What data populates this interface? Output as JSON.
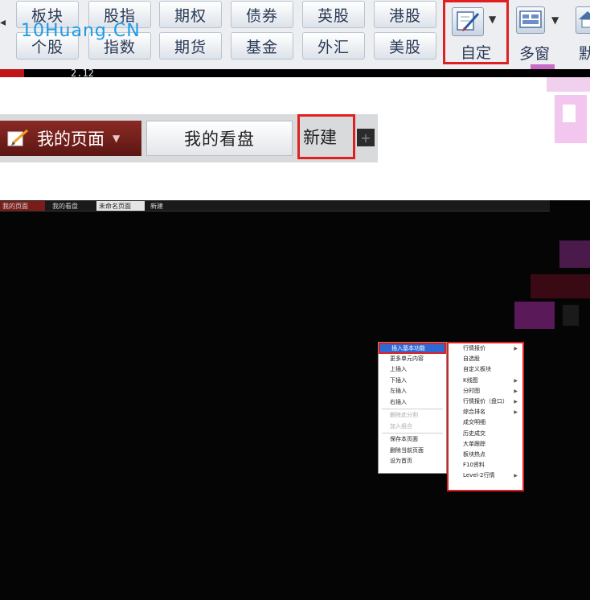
{
  "toolbar": {
    "row1": [
      "板块",
      "股指",
      "期权",
      "债券",
      "英股",
      "港股"
    ],
    "row2": [
      "个股",
      "指数",
      "期货",
      "基金",
      "外汇",
      "美股"
    ],
    "custom_label": "自定",
    "multi_label": "多窗",
    "home_label": "默",
    "quote_text": "2.12"
  },
  "brand": "10Huang.CN",
  "tabbar": {
    "my_page": "我的页面",
    "my_watch": "我的看盘",
    "new": "新建"
  },
  "screen": {
    "mini_tabs": [
      "我的页面",
      "我的看盘",
      "未命名页面",
      "新建"
    ],
    "context_menu": {
      "items": [
        {
          "label": "插入基本功能",
          "state": "selected"
        },
        {
          "label": "更多单元内容",
          "state": "normal"
        },
        {
          "label": "上插入",
          "state": "normal"
        },
        {
          "label": "下插入",
          "state": "normal"
        },
        {
          "label": "左插入",
          "state": "normal"
        },
        {
          "label": "右插入",
          "state": "normal"
        },
        {
          "label": "删除此分割",
          "state": "disabled"
        },
        {
          "label": "加入组合",
          "state": "disabled"
        },
        {
          "label": "保存本页面",
          "state": "normal"
        },
        {
          "label": "删除当前页面",
          "state": "normal"
        },
        {
          "label": "设为首页",
          "state": "normal"
        }
      ]
    },
    "submenu": {
      "items": [
        {
          "label": "行情报价",
          "arrow": true
        },
        {
          "label": "自选股",
          "arrow": false
        },
        {
          "label": "自定义板块",
          "arrow": false
        },
        {
          "label": "K线图",
          "arrow": true
        },
        {
          "label": "分时图",
          "arrow": true
        },
        {
          "label": "行情报价（盘口）",
          "arrow": true
        },
        {
          "label": "综合排名",
          "arrow": true
        },
        {
          "label": "成交明细",
          "arrow": false
        },
        {
          "label": "历史成交",
          "arrow": false
        },
        {
          "label": "大单跟踪",
          "arrow": false
        },
        {
          "label": "板块热点",
          "arrow": false
        },
        {
          "label": "F10资料",
          "arrow": false
        },
        {
          "label": "Level-2行情",
          "arrow": true
        }
      ]
    }
  },
  "colors": {
    "highlight_border": "#e02020",
    "tab_active": "#7a1c17",
    "menu_selected": "#2d6ad8",
    "screen_bg": "#050505"
  },
  "icons": [
    "edit-custom-icon",
    "multi-window-icon",
    "home-icon",
    "page-edit-icon",
    "dropdown-arrow-icon",
    "plus-icon",
    "submenu-arrow-icon"
  ]
}
